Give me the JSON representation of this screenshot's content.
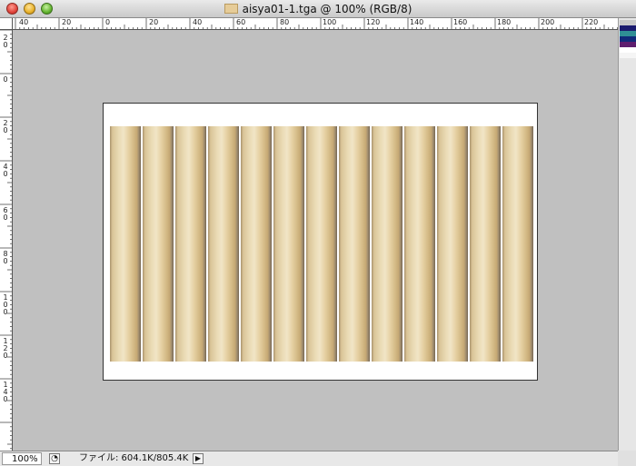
{
  "window": {
    "title": "aisya01-1.tga @ 100% (RGB/8)"
  },
  "ruler_h": {
    "labels": [
      "40",
      "20",
      "0",
      "20",
      "40",
      "60",
      "80",
      "100",
      "120",
      "140",
      "160",
      "180",
      "200",
      "220"
    ]
  },
  "ruler_v": {
    "labels": [
      [
        "2",
        "0"
      ],
      [
        "0"
      ],
      [
        "2",
        "0"
      ],
      [
        "4",
        "0"
      ],
      [
        "6",
        "0"
      ],
      [
        "8",
        "0"
      ],
      [
        "1",
        "0",
        "0"
      ],
      [
        "1",
        "2",
        "0"
      ],
      [
        "1",
        "4",
        "0"
      ]
    ]
  },
  "document": {
    "slat_count": 13,
    "colors": {
      "slat_light": "#f1e5c6",
      "slat_dark": "#8a7a62",
      "canvas_bg": "#c0c0c0"
    }
  },
  "statusbar": {
    "zoom": "100%",
    "file_info": "ファイル: 604.1K/805.4K",
    "arrow_icon": "triangle-right-icon"
  }
}
